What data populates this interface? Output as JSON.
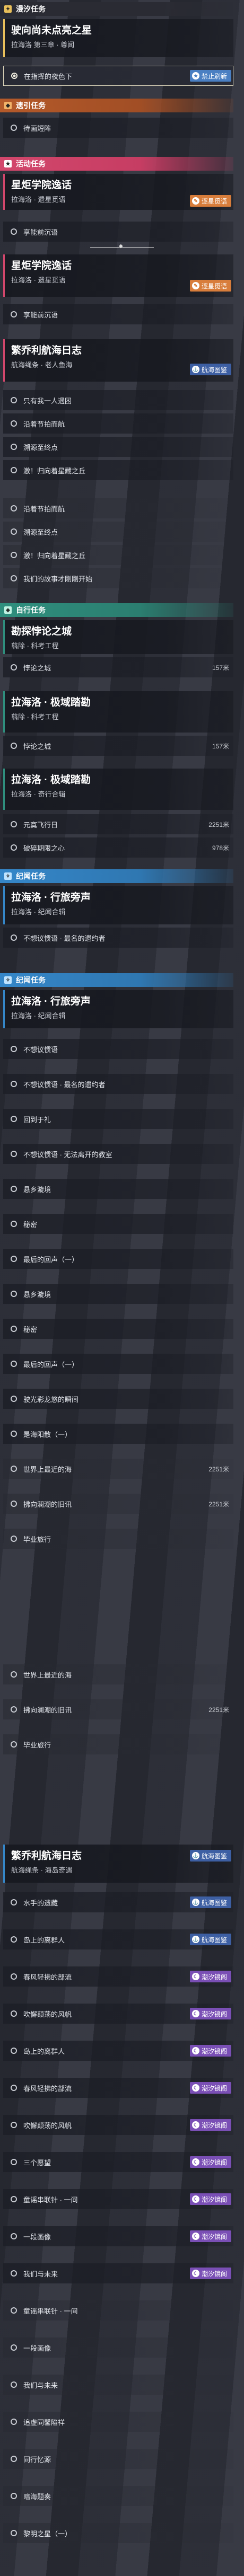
{
  "categories": {
    "main": "漫汐任务",
    "side": "遗引任务",
    "event": "活动任务",
    "explore": "自行任务",
    "jiyu": "纪闻任务"
  },
  "tags": {
    "forbid": "禁止刷新",
    "chase": "逐星觅语",
    "voyage": "航海图鉴",
    "moon": "潮汐镜阁"
  },
  "quests": {
    "q1": {
      "title": "驶向尚未点亮之星",
      "sub": "拉海洛 第三章 · 尊闻"
    },
    "q1_obj": "在指挥的夜色下",
    "side_obj": "待画短阵",
    "q2": {
      "title": "星炬学院逸话",
      "sub": "拉海洛 · 遗星觅语"
    },
    "q2_obj": "享能前沉语",
    "q3": {
      "title": "星炬学院逸话",
      "sub": "拉海洛 · 遗星觅语"
    },
    "q3_obj": "享能前沉语",
    "q4": {
      "title": "繁乔利航海日志",
      "sub": "航海绳条 · 老人鱼海"
    },
    "q4_objs": [
      "只有我一人遇困",
      "沿着节拍而航",
      "溯源至终点",
      "激！归向着星藏之丘"
    ],
    "q4_tail": [
      "沿着节拍而航",
      "溯源至终点",
      "激！归向着星藏之丘",
      "我们的故事才刚刚开始"
    ],
    "q5": {
      "title": "勘探悖论之城",
      "sub": "翦除 · 科考工程"
    },
    "q5_obj": "悖论之城",
    "q5_dist": "157米",
    "q6": {
      "title": "拉海洛 · 极域踏勘",
      "sub": "翦除 · 科考工程"
    },
    "q6_obj": "悖论之城",
    "q6_dist": "157米",
    "q7": {
      "title": "拉海洛 · 极域踏勘",
      "sub": "拉海洛 · 奇行合辑"
    },
    "q7_objs": [
      {
        "l": "元寞飞行日",
        "d": "2251米"
      },
      {
        "l": "破碎期限之心",
        "d": "978米"
      }
    ],
    "q8": {
      "title": "拉海洛 · 行旅旁声",
      "sub": "拉海洛 · 纪闻合辑"
    },
    "q8_obj": "不想议惯语 · 最名的遗约者",
    "q9": {
      "title": "拉海洛 · 行旅旁声",
      "sub": "拉海洛 · 纪闻合辑"
    },
    "q9_objs": [
      {
        "l": "不想议惯语",
        "d": ""
      },
      {
        "l": "不想议惯语 · 最名的遗约者",
        "d": ""
      },
      {
        "l": "回到于礼",
        "d": ""
      },
      {
        "l": "不想议惯语 · 无法离开的教室",
        "d": ""
      },
      {
        "l": "悬乡漩境",
        "d": ""
      },
      {
        "l": "秘密",
        "d": ""
      },
      {
        "l": "最后的回声（一）",
        "d": ""
      },
      {
        "l": "悬乡漩境",
        "d": ""
      },
      {
        "l": "秘密",
        "d": ""
      },
      {
        "l": "最后的回声（一）",
        "d": ""
      },
      {
        "l": "驶光彩龙悠的瞬间",
        "d": ""
      },
      {
        "l": "是海阳散（一）",
        "d": ""
      },
      {
        "l": "世界上最近的海",
        "d": "2251米"
      },
      {
        "l": "拂向澜潮的旧讯",
        "d": "2251米"
      },
      {
        "l": "毕业旅行",
        "d": ""
      }
    ],
    "q9_tail": [
      {
        "l": "世界上最近的海",
        "d": ""
      },
      {
        "l": "拂向澜潮的旧讯",
        "d": "2251米"
      },
      {
        "l": "毕业旅行",
        "d": ""
      }
    ],
    "q10": {
      "title": "繁乔利航海日志",
      "sub": "航海绳条 · 海岛奇遇"
    },
    "q10_objs": [
      {
        "l": "水手的遗藏",
        "t": "voyage"
      },
      {
        "l": "岛上的离群人",
        "t": "voyage"
      },
      {
        "l": "春风轻拂的部流",
        "t": "moon"
      },
      {
        "l": "吹懈颠荡的风帆",
        "t": "moon"
      },
      {
        "l": "岛上的离群人",
        "t": "moon"
      },
      {
        "l": "春风轻拂的部流",
        "t": "moon"
      },
      {
        "l": "吹懈颠荡的风帆",
        "t": "moon"
      },
      {
        "l": "三个愿望",
        "t": "moon"
      },
      {
        "l": "童谣串联针 · 一间",
        "t": "moon"
      },
      {
        "l": "一段画像",
        "t": "moon"
      },
      {
        "l": "我们与未来",
        "t": "moon"
      },
      {
        "l": "童谣串联针 · 一间",
        "t": ""
      },
      {
        "l": "一段画像",
        "t": ""
      },
      {
        "l": "我们与未来",
        "t": ""
      },
      {
        "l": "追虚同馨陷祥",
        "t": ""
      },
      {
        "l": "同行忆源",
        "t": ""
      },
      {
        "l": "暗海题奏",
        "t": ""
      },
      {
        "l": "黎明之星（一）",
        "t": ""
      }
    ]
  }
}
